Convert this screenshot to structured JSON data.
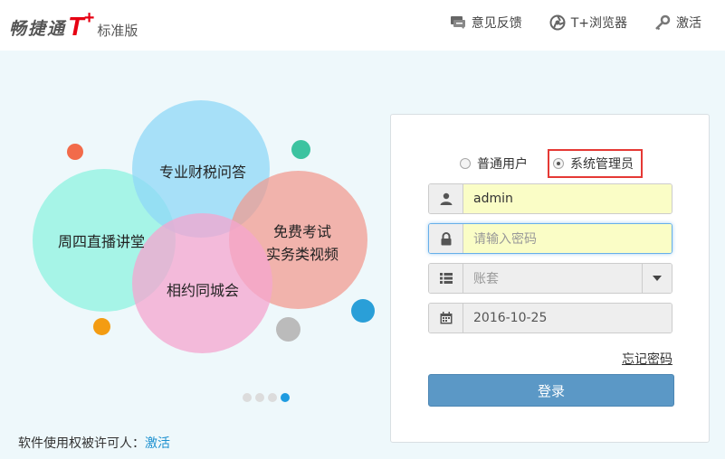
{
  "header": {
    "logo_cn": "畅捷通",
    "logo_t": "T",
    "logo_plus": "+",
    "logo_edition": "标准版",
    "links": [
      {
        "label": "意见反馈",
        "icon": "feedback-icon"
      },
      {
        "label": "T+浏览器",
        "icon": "browser-icon"
      },
      {
        "label": "激活",
        "icon": "key-icon"
      }
    ]
  },
  "carousel": {
    "bubbles": [
      {
        "label": "专业财税问答",
        "color": "#8fd8f7"
      },
      {
        "label": "周四直播讲堂",
        "color": "#8ef3e0"
      },
      {
        "label": "免费考试",
        "label2": "实务类视频",
        "color": "#f3998e"
      },
      {
        "label": "相约同城会",
        "color": "#f4a6cf"
      }
    ],
    "dots": [
      "#f26b4a",
      "#3cc3a0",
      "#f39c12",
      "#bbbbbb",
      "#2a9fd8"
    ],
    "pager_active_index": 3
  },
  "license": {
    "text": "软件使用权被许可人：",
    "link": "激活"
  },
  "login": {
    "roles": [
      {
        "label": "普通用户",
        "checked": false
      },
      {
        "label": "系统管理员",
        "checked": true
      }
    ],
    "username": "admin",
    "password_placeholder": "请输入密码",
    "account_placeholder": "账套",
    "date": "2016-10-25",
    "forgot": "忘记密码",
    "submit": "登录"
  },
  "colors": {
    "brand_red": "#e60012",
    "accent_blue": "#5b98c6",
    "highlight_border": "#e53935",
    "autofill_yellow": "#fafdc6"
  }
}
